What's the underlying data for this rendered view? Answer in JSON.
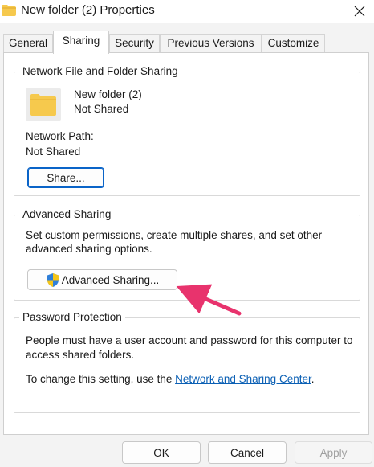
{
  "window": {
    "title": "New folder (2) Properties",
    "close_icon": "close-icon",
    "folder_icon": "folder-icon"
  },
  "tabs": [
    {
      "label": "General",
      "active": false
    },
    {
      "label": "Sharing",
      "active": true
    },
    {
      "label": "Security",
      "active": false
    },
    {
      "label": "Previous Versions",
      "active": false
    },
    {
      "label": "Customize",
      "active": false
    }
  ],
  "network_sharing": {
    "title": "Network File and Folder Sharing",
    "folder_name": "New folder (2)",
    "status": "Not Shared",
    "path_label": "Network Path:",
    "path_value": "Not Shared",
    "share_button": "Share..."
  },
  "advanced_sharing": {
    "title": "Advanced Sharing",
    "description_line1": "Set custom permissions, create multiple shares, and set other",
    "description_line2": "advanced sharing options.",
    "button_label": "Advanced Sharing...",
    "shield_icon": "uac-shield-icon"
  },
  "password_protection": {
    "title": "Password Protection",
    "line1": "People must have a user account and password for this computer to",
    "line2": "access shared folders.",
    "change_prefix": "To change this setting, use the ",
    "link_text": "Network and Sharing Center",
    "change_suffix": "."
  },
  "footer": {
    "ok": "OK",
    "cancel": "Cancel",
    "apply": "Apply",
    "apply_enabled": false
  },
  "colors": {
    "accent": "#0a64c8",
    "link": "#0a5fb4",
    "annotation_arrow": "#e8336d",
    "folder": "#f6c94d"
  }
}
